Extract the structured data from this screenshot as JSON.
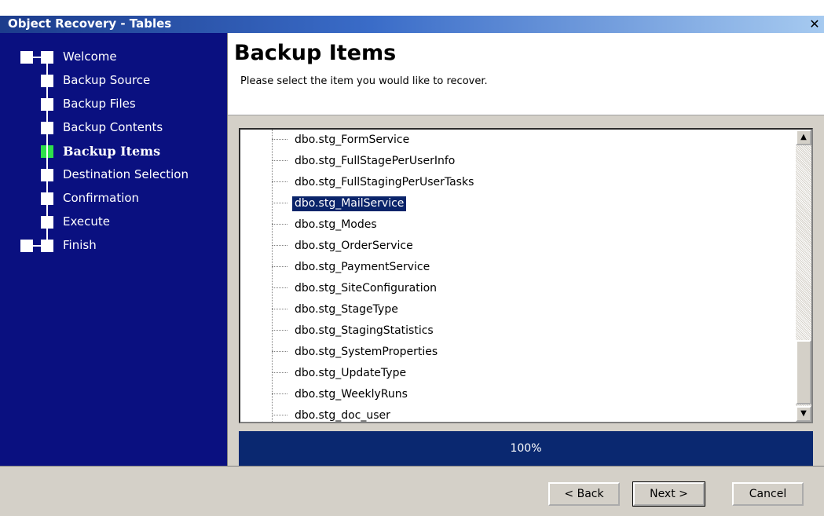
{
  "window": {
    "title": "Object Recovery - Tables",
    "close_glyph": "✕"
  },
  "steps": [
    {
      "label": "Welcome",
      "active": false
    },
    {
      "label": "Backup Source",
      "active": false
    },
    {
      "label": "Backup Files",
      "active": false
    },
    {
      "label": "Backup Contents",
      "active": false
    },
    {
      "label": "Backup Items",
      "active": true
    },
    {
      "label": "Destination Selection",
      "active": false
    },
    {
      "label": "Confirmation",
      "active": false
    },
    {
      "label": "Execute",
      "active": false
    },
    {
      "label": "Finish",
      "active": false
    }
  ],
  "header": {
    "title": "Backup Items",
    "subtitle": "Please select the item you would like to recover."
  },
  "tree": {
    "items": [
      "dbo.stg_FormService",
      "dbo.stg_FullStagePerUserInfo",
      "dbo.stg_FullStagingPerUserTasks",
      "dbo.stg_MailService",
      "dbo.stg_Modes",
      "dbo.stg_OrderService",
      "dbo.stg_PaymentService",
      "dbo.stg_SiteConfiguration",
      "dbo.stg_StageType",
      "dbo.stg_StagingStatistics",
      "dbo.stg_SystemProperties",
      "dbo.stg_UpdateType",
      "dbo.stg_WeeklyRuns",
      "dbo.stg_doc_user"
    ],
    "selected_index": 3
  },
  "scrollbar": {
    "up_glyph": "▲",
    "down_glyph": "▼"
  },
  "progress": {
    "text": "100%"
  },
  "buttons": {
    "back": "< Back",
    "next": "Next >",
    "cancel": "Cancel"
  },
  "colors": {
    "nav_background": "#0a1080",
    "active_step": "#2ee04a",
    "selection": "#0a246a",
    "progress": "#0a2870"
  }
}
